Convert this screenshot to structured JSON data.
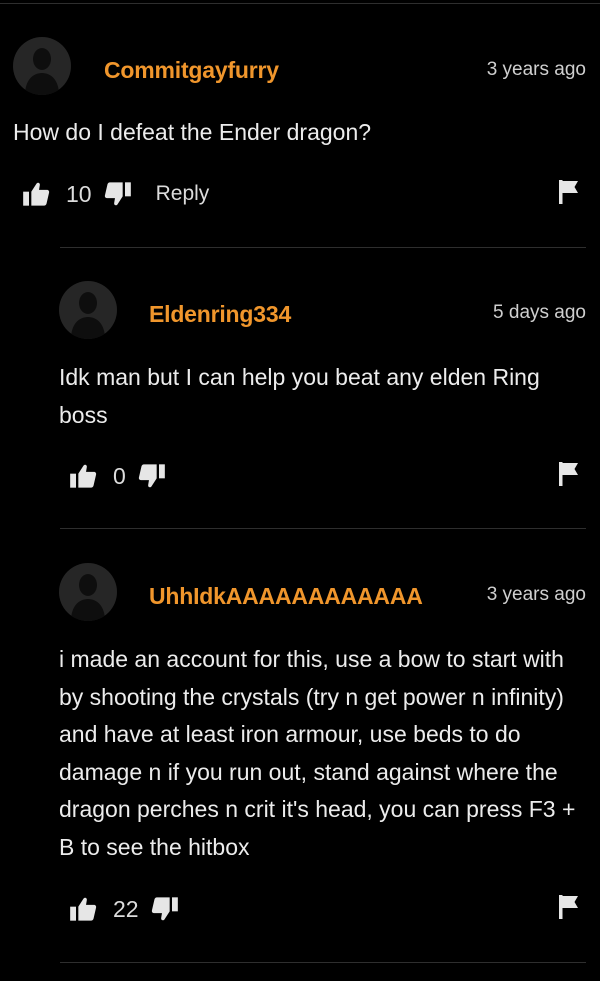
{
  "comments": [
    {
      "username": "Commitgayfurry",
      "timestamp": "3 years ago",
      "text": "How do I defeat the Ender dragon?",
      "likes": "10",
      "reply_label": "Reply"
    },
    {
      "username": "Eldenring334",
      "timestamp": "5 days ago",
      "text": "Idk man but I can help you beat any elden Ring boss",
      "likes": "0"
    },
    {
      "username": "UhhIdkAAAAAAAAAAAA",
      "timestamp": "3 years ago",
      "text": "i made an account for this, use a bow to start with by shooting the crystals (try n get power n infinity) and have at least iron armour, use beds to do damage n if you run out, stand against where the dragon perches n crit it's head, you can press F3 + B to see the hitbox",
      "likes": "22"
    }
  ],
  "icons": {
    "like": "thumbs-up-icon",
    "dislike": "thumbs-down-icon",
    "report": "flag-icon",
    "avatar": "user-silhouette-icon"
  },
  "colors": {
    "background": "#000000",
    "username": "#f0962c",
    "text": "#ececec",
    "muted": "#cfcfcf",
    "avatar": "#262626",
    "divider": "#2e2e2e"
  }
}
